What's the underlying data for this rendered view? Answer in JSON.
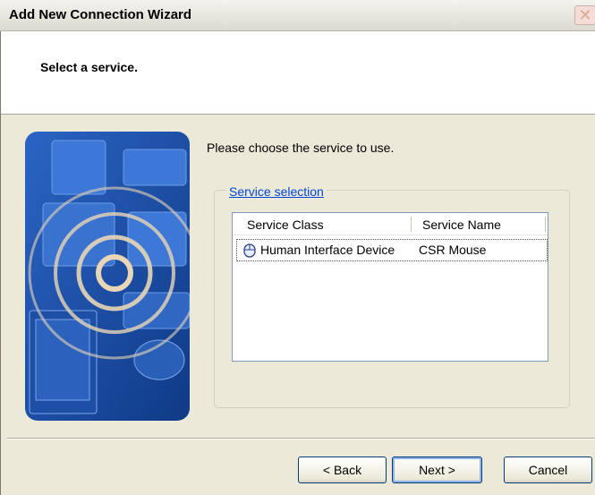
{
  "window": {
    "title": "Add New Connection Wizard",
    "close_glyph": "✕"
  },
  "header": {
    "title": "Select a service."
  },
  "prompt": "Please choose the service to use.",
  "group": {
    "legend": "Service selection"
  },
  "listview": {
    "columns": [
      "Service Class",
      "Service Name"
    ],
    "rows": [
      {
        "icon": "mouse-icon",
        "service_class": "Human Interface Device",
        "service_name": "CSR Mouse"
      }
    ]
  },
  "buttons": {
    "back": "< Back",
    "next": "Next >",
    "cancel": "Cancel"
  },
  "colors": {
    "accent_link": "#0046d5",
    "dialog_bg": "#ece9d8",
    "art_blue": "#1f4fa3"
  }
}
